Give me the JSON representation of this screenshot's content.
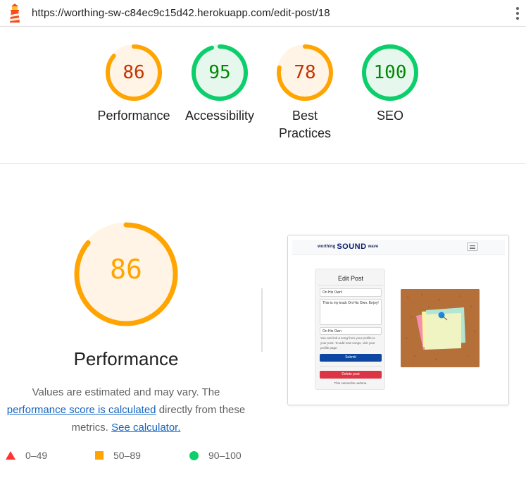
{
  "browser": {
    "url": "https://worthing-sw-c84ec9c15d42.herokuapp.com/edit-post/18",
    "menu_icon": "kebab-menu-icon",
    "logo_icon": "lighthouse-icon"
  },
  "scores": [
    {
      "label": "Performance",
      "score": 86,
      "status": "average"
    },
    {
      "label": "Accessibility",
      "score": 95,
      "status": "pass"
    },
    {
      "label": "Best Practices",
      "score": 78,
      "status": "average"
    },
    {
      "label": "SEO",
      "score": 100,
      "status": "pass"
    }
  ],
  "performance": {
    "score": 86,
    "title": "Performance",
    "desc_before": "Values are estimated and may vary. The",
    "desc_link": "performance score is calculated",
    "desc_after": "directly from these metrics.",
    "calculator_link": "See calculator."
  },
  "legend": [
    {
      "shape": "triangle",
      "range": "0–49",
      "color": "#ff3333"
    },
    {
      "shape": "square",
      "range": "50–89",
      "color": "#ffa400"
    },
    {
      "shape": "circle",
      "range": "90–100",
      "color": "#0cce6b"
    }
  ],
  "colors": {
    "pass_stroke": "#0cce6b",
    "pass_fill": "#e6f8ee",
    "pass_text": "#008800",
    "average_stroke": "#ffa400",
    "average_fill": "#fff4e5",
    "average_text": "#c33300",
    "big_average_text": "#ffa400"
  },
  "screenshot": {
    "brand_left": "worthing",
    "brand_mid": "SOUND",
    "brand_right": "wave",
    "card_title": "Edit Post",
    "title_value": "On His Own!",
    "body_value": "This is my track On His Own. Enjoy!",
    "song_value": "On His Own",
    "help_text": "You can link a song from your profile to your post. To add new songs, visit your profile page.",
    "submit_label": "Submit",
    "delete_label": "Delete post",
    "warning": "This cannot be undone."
  }
}
